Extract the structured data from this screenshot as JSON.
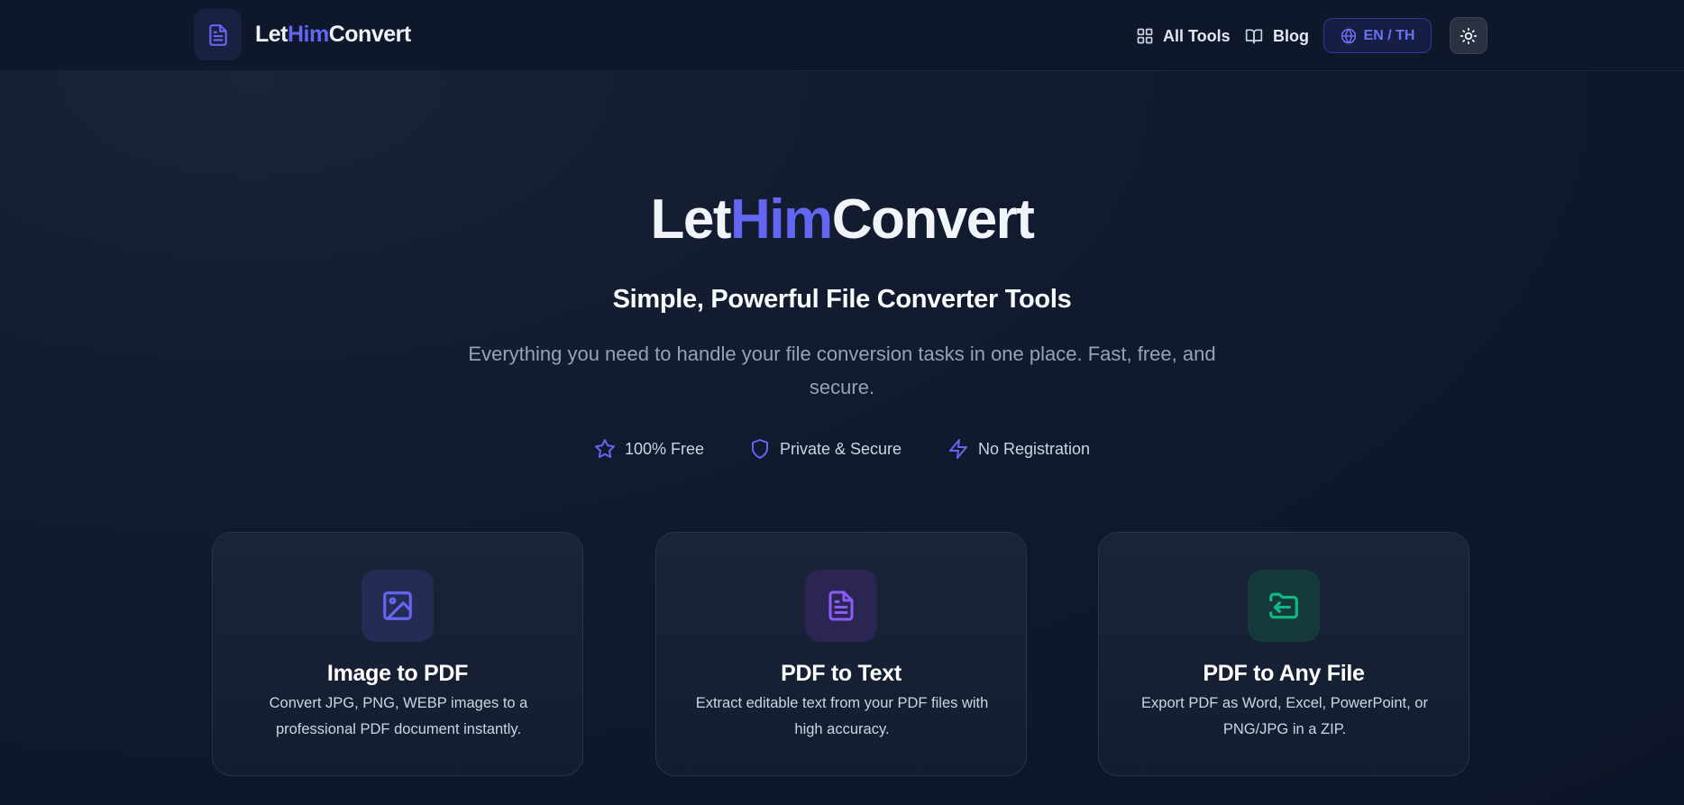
{
  "brand": {
    "part1": "Let",
    "part2": "Him",
    "part3": "Convert"
  },
  "nav": {
    "all_tools": "All Tools",
    "blog": "Blog",
    "language": "EN / TH"
  },
  "hero": {
    "title_part1": "Let",
    "title_part2": "Him",
    "title_part3": "Convert",
    "subtitle": "Simple, Powerful File Converter Tools",
    "description": "Everything you need to handle your file conversion tasks in one place. Fast, free, and secure."
  },
  "features": [
    {
      "label": "100% Free",
      "icon": "star-icon"
    },
    {
      "label": "Private & Secure",
      "icon": "shield-icon"
    },
    {
      "label": "No Registration",
      "icon": "lightning-icon"
    }
  ],
  "cards": [
    {
      "title": "Image to PDF",
      "description": "Convert JPG, PNG, WEBP images to a professional PDF document instantly.",
      "icon": "image-icon",
      "icon_color": "#6366f1",
      "icon_bg": "#252b55"
    },
    {
      "title": "PDF to Text",
      "description": "Extract editable text from your PDF files with high accuracy.",
      "icon": "document-icon",
      "icon_color": "#8b5cf6",
      "icon_bg": "#2a2552"
    },
    {
      "title": "PDF to Any File",
      "description": "Export PDF as Word, Excel, PowerPoint, or PNG/JPG in a ZIP.",
      "icon": "folder-export-icon",
      "icon_color": "#10b981",
      "icon_bg": "#163a3c"
    }
  ],
  "colors": {
    "accent": "#6366f1",
    "background": "#0f172a"
  }
}
